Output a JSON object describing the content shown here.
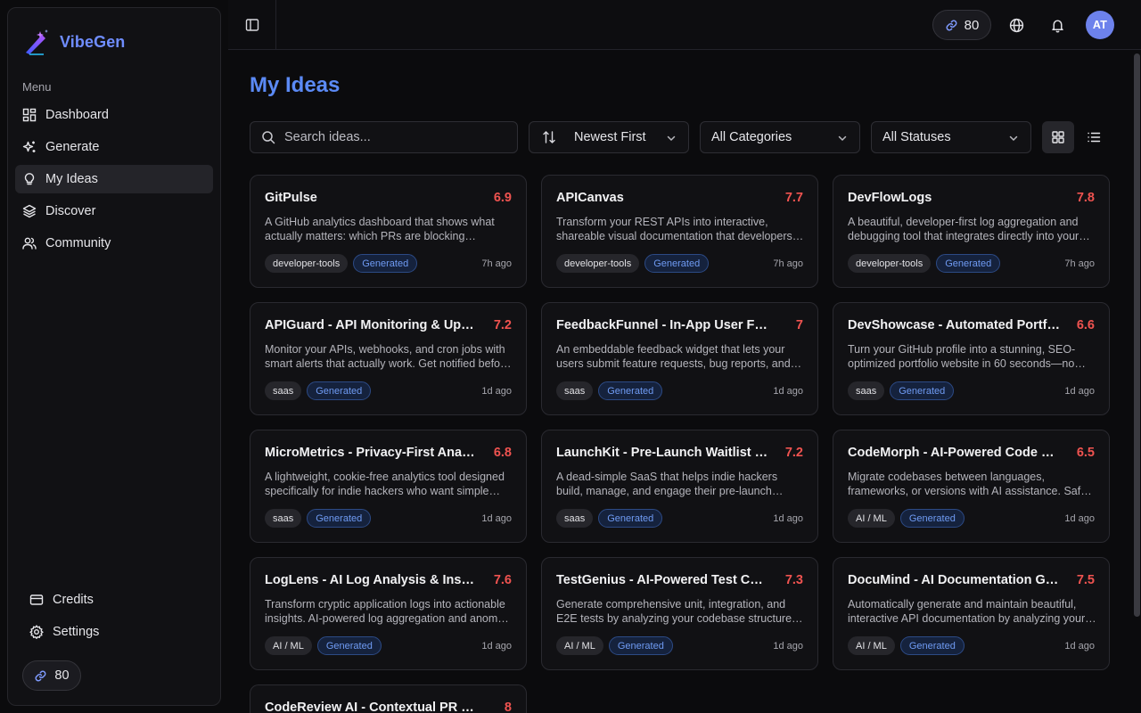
{
  "app": {
    "name": "VibeGen"
  },
  "sidebar": {
    "menu_label": "Menu",
    "items": [
      {
        "label": "Dashboard",
        "icon": "dashboard-icon"
      },
      {
        "label": "Generate",
        "icon": "sparkles-icon"
      },
      {
        "label": "My Ideas",
        "icon": "lightbulb-icon",
        "active": true
      },
      {
        "label": "Discover",
        "icon": "layers-icon"
      },
      {
        "label": "Community",
        "icon": "users-icon"
      }
    ],
    "bottom_items": [
      {
        "label": "Credits",
        "icon": "credit-card-icon"
      },
      {
        "label": "Settings",
        "icon": "gear-icon"
      }
    ],
    "credits": "80"
  },
  "header": {
    "credits": "80",
    "avatar_initials": "AT"
  },
  "main": {
    "title": "My Ideas",
    "search_placeholder": "Search ideas...",
    "sort": "Newest First",
    "category": "All Categories",
    "status": "All Statuses"
  },
  "colors": {
    "accent": "#5b8af5",
    "score": "#ef5350",
    "avatar": "#6d82ec"
  },
  "ideas": [
    {
      "title": "GitPulse",
      "score": "6.9",
      "desc": "A GitHub analytics dashboard that shows what actually matters: which PRs are blocking development and where your team spends its time.",
      "category": "developer-tools",
      "status": "Generated",
      "time": "7h ago"
    },
    {
      "title": "APICanvas",
      "score": "7.7",
      "desc": "Transform your REST APIs into interactive, shareable visual documentation that developers actually enjoy using.",
      "category": "developer-tools",
      "status": "Generated",
      "time": "7h ago"
    },
    {
      "title": "DevFlowLogs",
      "score": "7.8",
      "desc": "A beautiful, developer-first log aggregation and debugging tool that integrates directly into your workflow.",
      "category": "developer-tools",
      "status": "Generated",
      "time": "7h ago"
    },
    {
      "title": "APIGuard - API Monitoring & Uptime",
      "score": "7.2",
      "desc": "Monitor your APIs, webhooks, and cron jobs with smart alerts that actually work. Get notified before your users do.",
      "category": "saas",
      "status": "Generated",
      "time": "1d ago"
    },
    {
      "title": "FeedbackFunnel - In-App User Feedback",
      "score": "7",
      "desc": "An embeddable feedback widget that lets your users submit feature requests, bug reports, and ideas in seconds.",
      "category": "saas",
      "status": "Generated",
      "time": "1d ago"
    },
    {
      "title": "DevShowcase - Automated Portfolio",
      "score": "6.6",
      "desc": "Turn your GitHub profile into a stunning, SEO-optimized portfolio website in 60 seconds—no coding required.",
      "category": "saas",
      "status": "Generated",
      "time": "1d ago"
    },
    {
      "title": "MicroMetrics - Privacy-First Analytics",
      "score": "6.8",
      "desc": "A lightweight, cookie-free analytics tool designed specifically for indie hackers who want simple insights.",
      "category": "saas",
      "status": "Generated",
      "time": "1d ago"
    },
    {
      "title": "LaunchKit - Pre-Launch Waitlist & Referrals",
      "score": "7.2",
      "desc": "A dead-simple SaaS that helps indie hackers build, manage, and engage their pre-launch waitlists.",
      "category": "saas",
      "status": "Generated",
      "time": "1d ago"
    },
    {
      "title": "CodeMorph - AI-Powered Code Migration",
      "score": "6.5",
      "desc": "Migrate codebases between languages, frameworks, or versions with AI assistance. Safe and incremental.",
      "category": "AI / ML",
      "status": "Generated",
      "time": "1d ago"
    },
    {
      "title": "LogLens - AI Log Analysis & Insights",
      "score": "7.6",
      "desc": "Transform cryptic application logs into actionable insights. AI-powered log aggregation and anomaly detection.",
      "category": "AI / ML",
      "status": "Generated",
      "time": "1d ago"
    },
    {
      "title": "TestGenius - AI-Powered Test Case Generator",
      "score": "7.3",
      "desc": "Generate comprehensive unit, integration, and E2E tests by analyzing your codebase structure automatically.",
      "category": "AI / ML",
      "status": "Generated",
      "time": "1d ago"
    },
    {
      "title": "DocuMind - AI Documentation Generator",
      "score": "7.5",
      "desc": "Automatically generate and maintain beautiful, interactive API documentation by analyzing your code.",
      "category": "AI / ML",
      "status": "Generated",
      "time": "1d ago"
    },
    {
      "title": "CodeReview AI - Contextual PR Reviews",
      "score": "8",
      "desc": "",
      "category": "",
      "status": "",
      "time": ""
    }
  ]
}
